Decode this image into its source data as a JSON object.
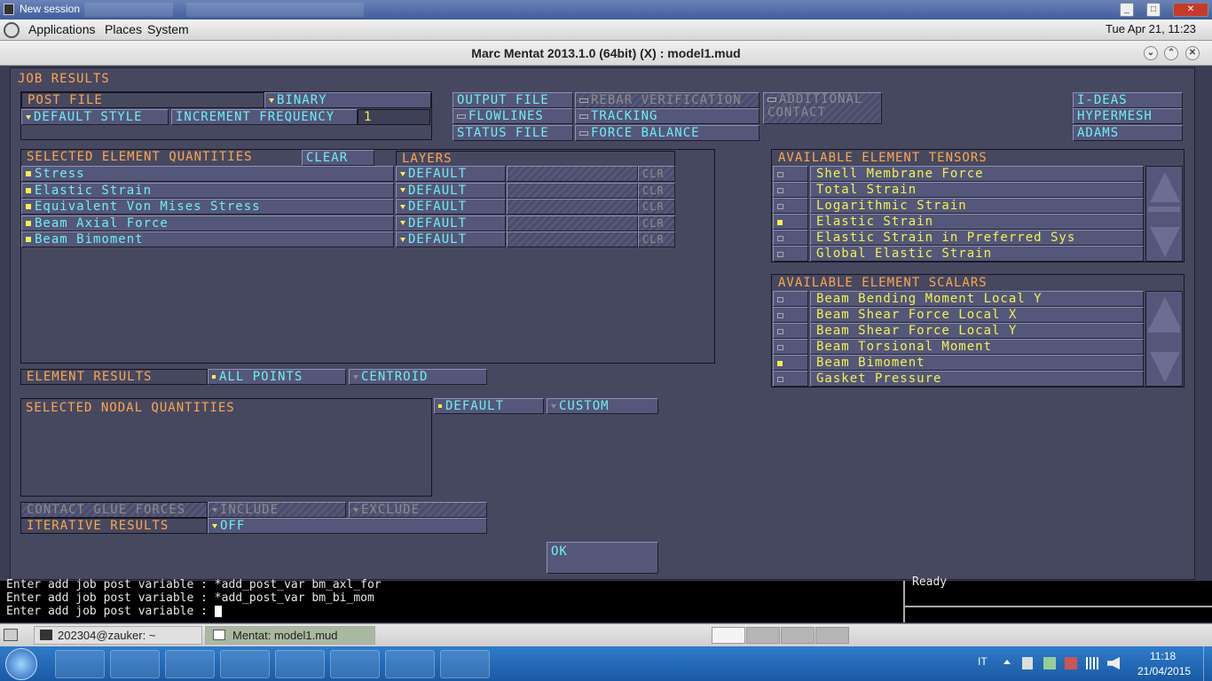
{
  "session_bar": {
    "title": "New session"
  },
  "gnome_panel": {
    "menus": [
      "Applications",
      "Places",
      "System"
    ],
    "clock": "Tue Apr 21, 11:23"
  },
  "window": {
    "title": "Marc Mentat 2013.1.0 (64bit) (X) : model1.mud"
  },
  "dialog": {
    "title": "JOB RESULTS",
    "post_file": {
      "label": "POST FILE",
      "value": "BINARY"
    },
    "default_style": "DEFAULT STYLE",
    "increment_frequency": {
      "label": "INCREMENT FREQUENCY",
      "value": "1"
    },
    "output_file": "OUTPUT FILE",
    "rebar_verification": "REBAR VERIFICATION",
    "additional_contact": "ADDITIONAL CONTACT",
    "flowlines": "FLOWLINES",
    "tracking": "TRACKING",
    "status_file": "STATUS FILE",
    "force_balance": "FORCE BALANCE",
    "ideas": "I-DEAS",
    "hypermesh": "HYPERMESH",
    "adams": "ADAMS",
    "selected_elem": {
      "title": "SELECTED ELEMENT QUANTITIES",
      "clear": "CLEAR",
      "layers": "LAYERS",
      "rows": [
        {
          "name": "Stress",
          "layer": "DEFAULT",
          "clr": "CLR"
        },
        {
          "name": "Elastic Strain",
          "layer": "DEFAULT",
          "clr": "CLR"
        },
        {
          "name": "Equivalent Von Mises Stress",
          "layer": "DEFAULT",
          "clr": "CLR"
        },
        {
          "name": "Beam Axial Force",
          "layer": "DEFAULT",
          "clr": "CLR"
        },
        {
          "name": "Beam Bimoment",
          "layer": "DEFAULT",
          "clr": "CLR"
        }
      ]
    },
    "tensors": {
      "title": "AVAILABLE ELEMENT TENSORS",
      "items": [
        {
          "name": "Shell Membrane Force",
          "selected": false
        },
        {
          "name": "Total Strain",
          "selected": false
        },
        {
          "name": "Logarithmic Strain",
          "selected": false
        },
        {
          "name": "Elastic Strain",
          "selected": true
        },
        {
          "name": "Elastic Strain in Preferred Sys",
          "selected": false
        },
        {
          "name": "Global Elastic Strain",
          "selected": false
        }
      ]
    },
    "scalars": {
      "title": "AVAILABLE ELEMENT SCALARS",
      "items": [
        {
          "name": "Beam Bending Moment Local Y",
          "selected": false
        },
        {
          "name": "Beam Shear Force Local X",
          "selected": false
        },
        {
          "name": "Beam Shear Force Local Y",
          "selected": false
        },
        {
          "name": "Beam Torsional Moment",
          "selected": false
        },
        {
          "name": "Beam Bimoment",
          "selected": true
        },
        {
          "name": "Gasket Pressure",
          "selected": false
        }
      ]
    },
    "element_results": {
      "label": "ELEMENT RESULTS",
      "all_points": "ALL POINTS",
      "centroid": "CENTROID"
    },
    "nodal": {
      "title": "SELECTED NODAL QUANTITIES",
      "default": "DEFAULT",
      "custom": "CUSTOM"
    },
    "contact_glue": {
      "label": "CONTACT GLUE FORCES",
      "include": "INCLUDE",
      "exclude": "EXCLUDE"
    },
    "iterative": {
      "label": "ITERATIVE RESULTS",
      "value": "OFF"
    },
    "ok": "OK"
  },
  "terminal": {
    "lines": [
      "Enter add job post variable : *add_post_var bm_axl_for",
      "Enter add job post variable : *add_post_var bm_bi_mom",
      "Enter add job post variable : "
    ],
    "status": "Ready"
  },
  "taskbar": {
    "items": [
      "202304@zauker: ~",
      "Mentat: model1.mud"
    ]
  },
  "tray": {
    "lang": "IT",
    "time": "11:18",
    "date": "21/04/2015"
  }
}
